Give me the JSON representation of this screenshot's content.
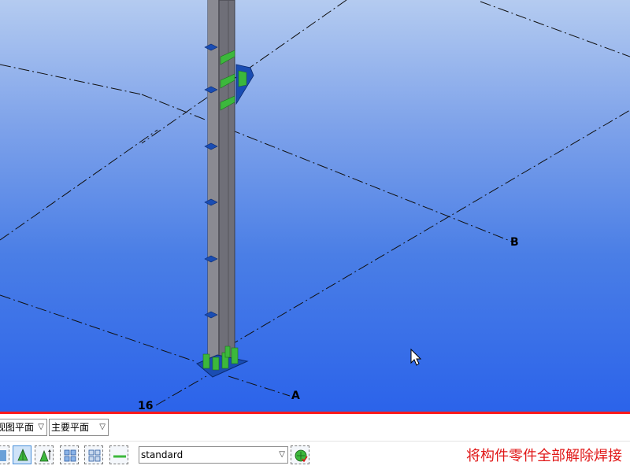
{
  "viewport": {
    "grid_labels": {
      "axis_b": "B",
      "axis_a": "A",
      "axis_16": "16"
    }
  },
  "toolbar": {
    "view_plane_select": {
      "value": "视图平面"
    },
    "main_plane_select": {
      "value": "主要平面"
    },
    "standard_select": {
      "value": "standard"
    },
    "buttons": [
      {
        "name": "snap-pyramid-button",
        "active": true
      },
      {
        "name": "snap-pyramid-alt-button",
        "active": false
      },
      {
        "name": "grid-select-button",
        "active": false
      },
      {
        "name": "grid-select-alt-button",
        "active": false
      },
      {
        "name": "line-tool-button",
        "active": false
      }
    ]
  },
  "caption": {
    "text": "将构件零件全部解除焊接"
  },
  "colors": {
    "accent_red": "#ff1a1a",
    "weld_green": "#3cb83c",
    "plate_blue": "#1a4db3",
    "column_gray": "#6f6f78"
  }
}
